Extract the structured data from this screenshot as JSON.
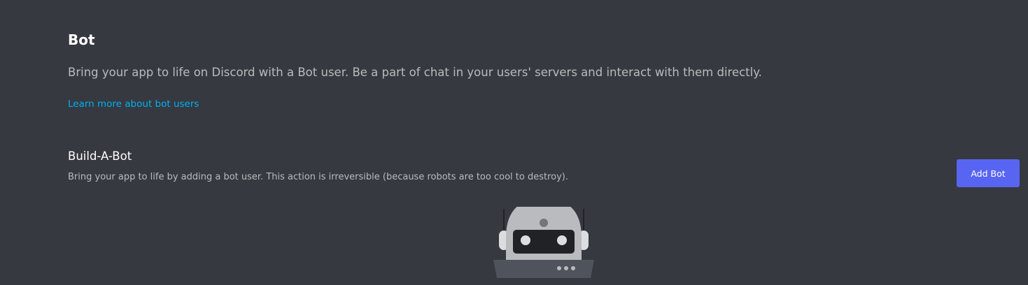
{
  "header": {
    "title": "Bot",
    "description": "Bring your app to life on Discord with a Bot user. Be a part of chat in your users' servers and interact with them directly.",
    "learn_more_link": "Learn more about bot users"
  },
  "build_a_bot": {
    "title": "Build-A-Bot",
    "description": "Bring your app to life by adding a bot user. This action is irreversible (because robots are too cool to destroy).",
    "add_button_label": "Add Bot"
  },
  "illustration": {
    "icon": "robot-illustration"
  },
  "colors": {
    "background": "#36393f",
    "link": "#00b0f4",
    "accent": "#5865f2"
  }
}
